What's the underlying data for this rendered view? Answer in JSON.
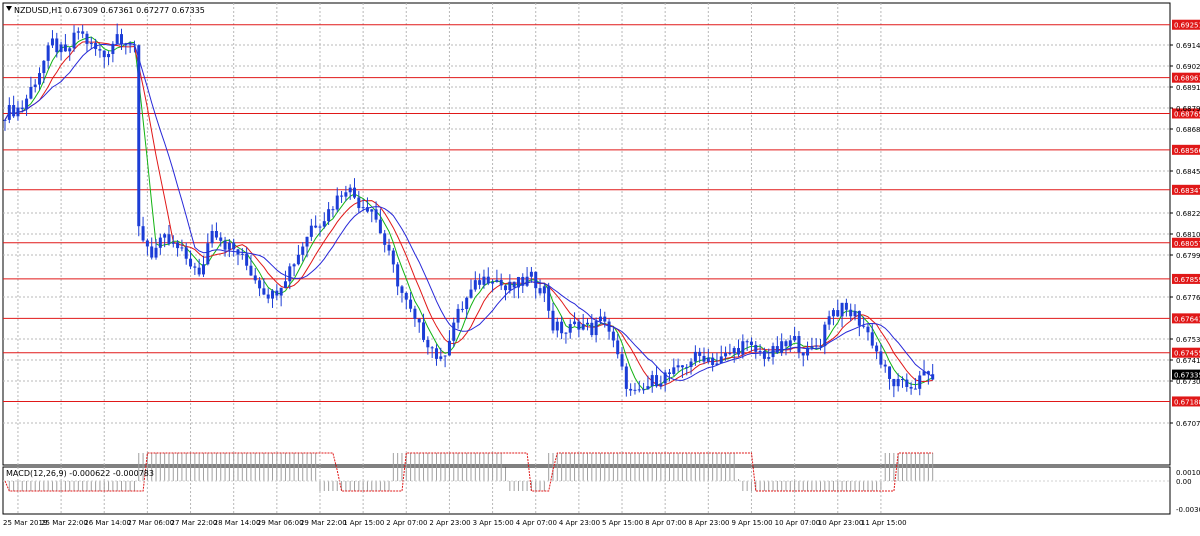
{
  "header": {
    "symbol_line": "NZDUSD,H1  0.67309 0.67361 0.67277 0.67335"
  },
  "macd": {
    "label": "MACD(12,26,9) -0.000622 -0.000783",
    "y_ticks": [
      "0.00106",
      "0.00",
      "-0.00301"
    ]
  },
  "colors": {
    "candles": "#1c3dd6",
    "ma_fast": "#13b313",
    "ma_mid": "#e01818",
    "ma_slow": "#2828d8",
    "level_line": "#e01818",
    "level_label_bg": "#e01818",
    "current_price_bg": "#000000",
    "grid": "#b8b8b8",
    "macd_signal": "#e01818",
    "macd_hist": "#a0a0a0"
  },
  "chart_data": {
    "type": "line",
    "title": "NZDUSD,H1",
    "ohlc_last": {
      "open": 0.67309,
      "high": 0.67361,
      "low": 0.67277,
      "close": 0.67335
    },
    "ylim": [
      0.6707,
      0.6705
    ],
    "y_ticks": [
      "0.69140",
      "0.69025",
      "0.68910",
      "0.68795",
      "0.68680",
      "0.68450",
      "0.68220",
      "0.68105",
      "0.67990",
      "0.67760",
      "0.67530",
      "0.67415",
      "0.67300",
      "0.67070"
    ],
    "x_ticks": [
      "25 Mar 2019",
      "25 Mar 22:00",
      "26 Mar 14:00",
      "27 Mar 06:00",
      "27 Mar 22:00",
      "28 Mar 14:00",
      "29 Mar 06:00",
      "29 Mar 22:00",
      "1 Apr 15:00",
      "2 Apr 07:00",
      "2 Apr 23:00",
      "3 Apr 15:00",
      "4 Apr 07:00",
      "4 Apr 23:00",
      "5 Apr 15:00",
      "8 Apr 07:00",
      "8 Apr 23:00",
      "9 Apr 15:00",
      "10 Apr 07:00",
      "10 Apr 23:00",
      "11 Apr 15:00"
    ],
    "levels": [
      "0.69251",
      "0.68961",
      "0.68765",
      "0.68566",
      "0.68347",
      "0.68057",
      "0.67859",
      "0.67643",
      "0.67455",
      "0.67188"
    ],
    "current_price": "0.67335",
    "price_path": [
      [
        0,
        0.6877
      ],
      [
        4,
        0.688
      ],
      [
        8,
        0.69
      ],
      [
        11,
        0.6915
      ],
      [
        14,
        0.6908
      ],
      [
        17,
        0.6922
      ],
      [
        20,
        0.6913
      ],
      [
        23,
        0.6908
      ],
      [
        26,
        0.692
      ],
      [
        29,
        0.6915
      ],
      [
        30,
        0.691
      ],
      [
        31,
        0.6813
      ],
      [
        34,
        0.68
      ],
      [
        37,
        0.6807
      ],
      [
        40,
        0.6802
      ],
      [
        43,
        0.6795
      ],
      [
        45,
        0.6786
      ],
      [
        48,
        0.6815
      ],
      [
        51,
        0.6805
      ],
      [
        54,
        0.68
      ],
      [
        57,
        0.679
      ],
      [
        60,
        0.678
      ],
      [
        62,
        0.6777
      ],
      [
        65,
        0.6788
      ],
      [
        68,
        0.68
      ],
      [
        71,
        0.6815
      ],
      [
        74,
        0.682
      ],
      [
        77,
        0.683
      ],
      [
        79,
        0.6837
      ],
      [
        82,
        0.6828
      ],
      [
        85,
        0.6825
      ],
      [
        87,
        0.6812
      ],
      [
        89,
        0.6798
      ],
      [
        92,
        0.6778
      ],
      [
        95,
        0.6762
      ],
      [
        98,
        0.6752
      ],
      [
        101,
        0.674
      ],
      [
        104,
        0.6762
      ],
      [
        107,
        0.6775
      ],
      [
        110,
        0.6785
      ],
      [
        113,
        0.6788
      ],
      [
        116,
        0.678
      ],
      [
        119,
        0.6783
      ],
      [
        122,
        0.6786
      ],
      [
        125,
        0.678
      ],
      [
        127,
        0.676
      ],
      [
        130,
        0.6757
      ],
      [
        133,
        0.6762
      ],
      [
        136,
        0.6758
      ],
      [
        139,
        0.6765
      ],
      [
        141,
        0.675
      ],
      [
        143,
        0.6735
      ],
      [
        145,
        0.6723
      ],
      [
        147,
        0.6722
      ],
      [
        150,
        0.673
      ],
      [
        153,
        0.6733
      ],
      [
        156,
        0.6735
      ],
      [
        159,
        0.6742
      ],
      [
        162,
        0.6744
      ],
      [
        165,
        0.674
      ],
      [
        168,
        0.6745
      ],
      [
        171,
        0.675
      ],
      [
        174,
        0.6746
      ],
      [
        177,
        0.6744
      ],
      [
        180,
        0.6748
      ],
      [
        183,
        0.6752
      ],
      [
        186,
        0.6745
      ],
      [
        189,
        0.6752
      ],
      [
        191,
        0.6768
      ],
      [
        194,
        0.6769
      ],
      [
        197,
        0.6766
      ],
      [
        199,
        0.676
      ],
      [
        201,
        0.6752
      ],
      [
        203,
        0.674
      ],
      [
        205,
        0.673
      ],
      [
        208,
        0.6727
      ],
      [
        211,
        0.6728
      ],
      [
        213,
        0.6733
      ]
    ]
  }
}
